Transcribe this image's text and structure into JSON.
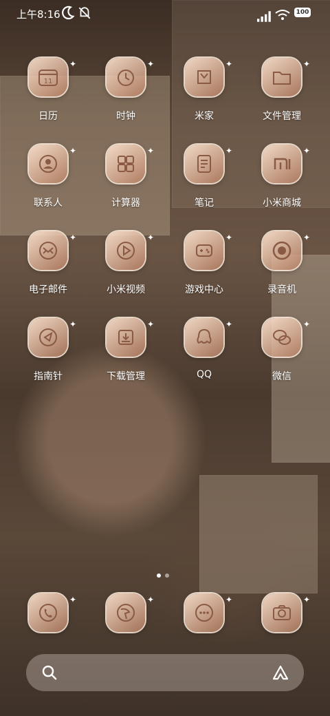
{
  "status": {
    "time": "上午8:16",
    "battery": "100"
  },
  "apps": [
    {
      "label": "日历",
      "icon": "calendar-icon"
    },
    {
      "label": "时钟",
      "icon": "clock-icon"
    },
    {
      "label": "米家",
      "icon": "mijia-icon"
    },
    {
      "label": "文件管理",
      "icon": "folder-icon"
    },
    {
      "label": "联系人",
      "icon": "contacts-icon"
    },
    {
      "label": "计算器",
      "icon": "calculator-icon"
    },
    {
      "label": "笔记",
      "icon": "notes-icon"
    },
    {
      "label": "小米商城",
      "icon": "mi-store-icon"
    },
    {
      "label": "电子邮件",
      "icon": "mail-icon"
    },
    {
      "label": "小米视频",
      "icon": "video-icon"
    },
    {
      "label": "游戏中心",
      "icon": "gamepad-icon"
    },
    {
      "label": "录音机",
      "icon": "recorder-icon"
    },
    {
      "label": "指南针",
      "icon": "compass-icon"
    },
    {
      "label": "下载管理",
      "icon": "download-icon"
    },
    {
      "label": "QQ",
      "icon": "qq-icon"
    },
    {
      "label": "微信",
      "icon": "wechat-icon"
    }
  ],
  "dock": [
    {
      "icon": "phone-icon"
    },
    {
      "icon": "browser-icon"
    },
    {
      "icon": "messages-icon"
    },
    {
      "icon": "camera-icon"
    }
  ],
  "pages": {
    "count": 2,
    "current": 1
  },
  "colors": {
    "icon_frame": "#f5dcc8",
    "icon_glyph": "#8a5a44"
  }
}
